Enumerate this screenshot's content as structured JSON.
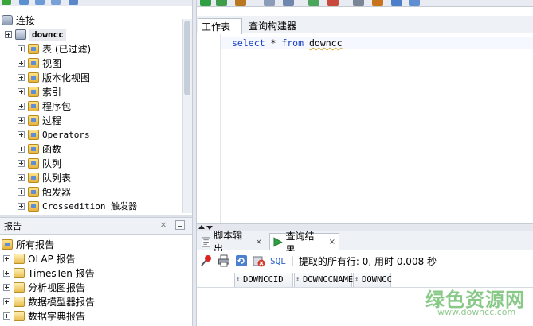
{
  "connections": {
    "title": "连接",
    "connection_name": "downcc",
    "tree": [
      {
        "label": "表 (已过滤)",
        "icon": "table-folder-icon"
      },
      {
        "label": "视图",
        "icon": "view-folder-icon"
      },
      {
        "label": "版本化视图",
        "icon": "editioned-view-folder-icon"
      },
      {
        "label": "索引",
        "icon": "index-folder-icon"
      },
      {
        "label": "程序包",
        "icon": "package-folder-icon"
      },
      {
        "label": "过程",
        "icon": "procedure-folder-icon"
      },
      {
        "label": "Operators",
        "icon": "operator-folder-icon"
      },
      {
        "label": "函数",
        "icon": "function-folder-icon"
      },
      {
        "label": "队列",
        "icon": "queue-folder-icon"
      },
      {
        "label": "队列表",
        "icon": "queue-table-folder-icon"
      },
      {
        "label": "触发器",
        "icon": "trigger-folder-icon"
      },
      {
        "label": "Crossedition 触发器",
        "icon": "crossedition-trigger-folder-icon"
      }
    ]
  },
  "reports": {
    "title": "报告",
    "close_glyph": "×",
    "root_label": "所有报告",
    "items": [
      {
        "label": "OLAP 报告"
      },
      {
        "label": "TimesTen 报告"
      },
      {
        "label": "分析视图报告"
      },
      {
        "label": "数据模型器报告"
      },
      {
        "label": "数据字典报告"
      }
    ]
  },
  "editor": {
    "tabs": [
      {
        "label": "工作表"
      },
      {
        "label": "查询构建器"
      }
    ],
    "sql": {
      "kw_select": "select",
      "star": " * ",
      "kw_from": "from",
      "table": "downcc"
    }
  },
  "results": {
    "tabs": [
      {
        "label": "脚本输出",
        "close": "×"
      },
      {
        "label": "查询结果",
        "close": "×"
      }
    ],
    "toolbar": {
      "sql_label": "SQL",
      "separator": "|",
      "status": "提取的所有行: 0, 用时 0.008 秒"
    },
    "columns": [
      "DOWNCCID",
      "DOWNCCNAME",
      "DOWNCC"
    ]
  },
  "watermark": {
    "text": "绿色资源网",
    "url": "www.downcc.com"
  },
  "colors": {
    "keyword": "#1b3fbf",
    "watermark": "#7cc47c",
    "run_green": "#2ea043"
  }
}
